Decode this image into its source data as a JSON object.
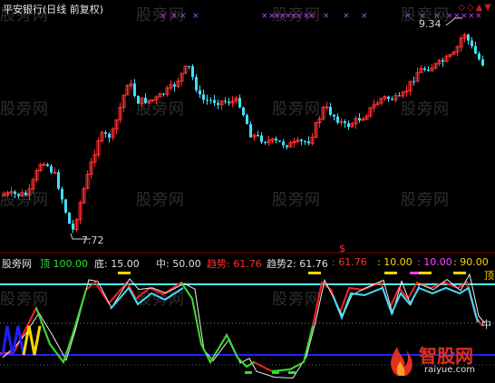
{
  "title": "平安银行(日线 前复权)",
  "watermark": "股旁网",
  "toolbar_icons": [
    "diamond-icon",
    "diamond-icon",
    "up-arrow-icon",
    "down-arrow-icon"
  ],
  "price": {
    "high_label": "9.34",
    "low_label": "7.72"
  },
  "indicator": {
    "source": "股旁网",
    "top_label": "顶",
    "top_value": "100.00",
    "bottom_label": "底",
    "bottom_value": "15.00",
    "mid_label": "中",
    "mid_value": "50.00",
    "trend_label": "趋势",
    "trend_value": "61.76",
    "trend2_label": "趋势2",
    "trend2_value": "61.76",
    "trend2_value_b": "61.76",
    "v1": "10.00",
    "v2": "10.00",
    "v3": "90.00",
    "dollar": "$",
    "right_top": "顶",
    "right_mid": "中"
  },
  "logo": {
    "text": "智股网",
    "url": "raiyue.com"
  },
  "colors": {
    "up": "#ff3030",
    "down": "#40e0ff",
    "cross": "#c040ff",
    "cyan_line": "#40ffff",
    "blue_line": "#2020ff",
    "trend_green": "#30e030",
    "trend_red": "#ff2020",
    "top_color": "#30e030",
    "yellow": "#ffd700",
    "magenta": "#ff40ff"
  }
}
